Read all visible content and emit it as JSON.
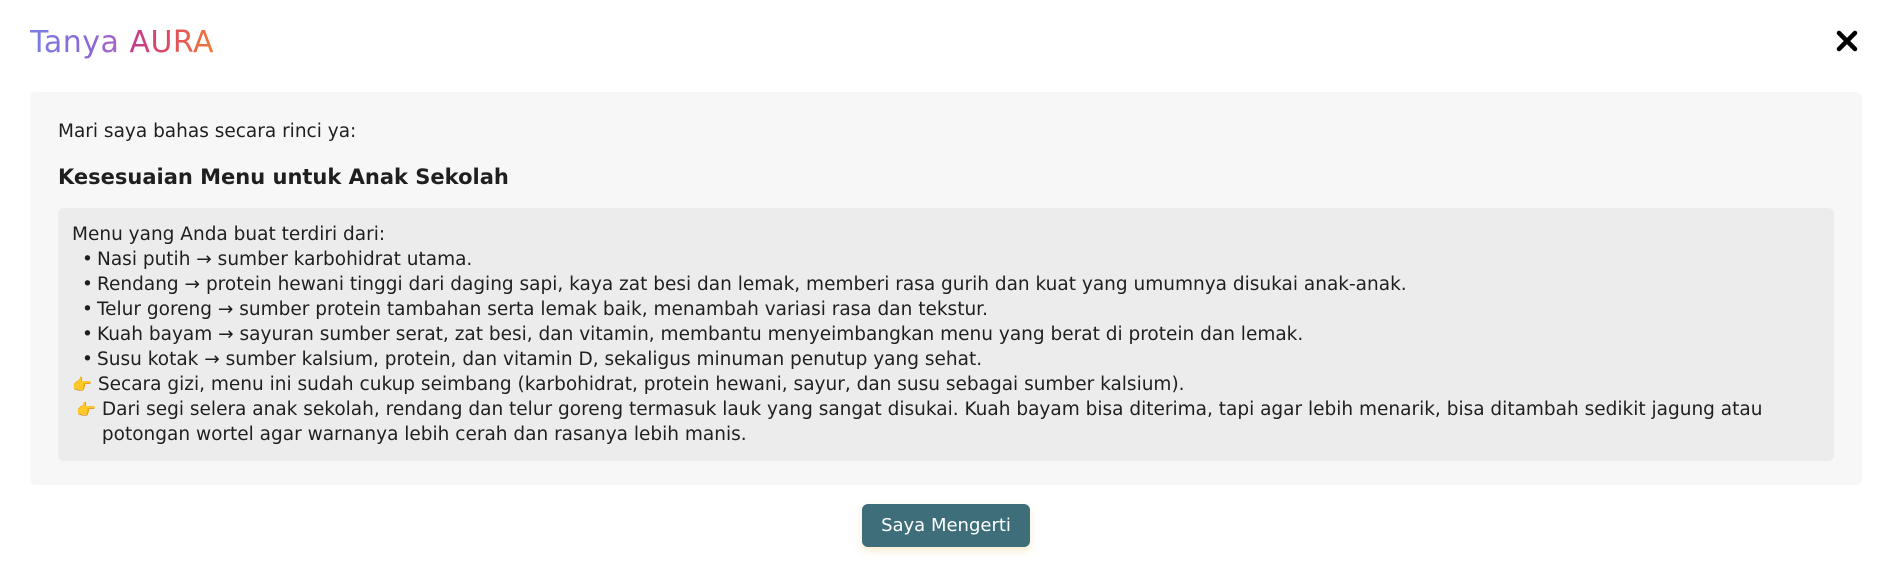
{
  "header": {
    "title_part1": "Tanya ",
    "title_part2": "AURA"
  },
  "content": {
    "intro": "Mari saya bahas secara rinci ya:",
    "section_title": "Kesesuaian Menu untuk Anak Sekolah",
    "menu_intro": "Menu yang Anda buat terdiri dari:",
    "bullets": [
      "Nasi putih → sumber karbohidrat utama.",
      "Rendang → protein hewani tinggi dari daging sapi, kaya zat besi dan lemak, memberi rasa gurih dan kuat yang umumnya disukai anak-anak.",
      "Telur goreng → sumber protein tambahan serta lemak baik, menambah variasi rasa dan tekstur.",
      "Kuah bayam → sayuran sumber serat, zat besi, dan vitamin, membantu menyeimbangkan menu yang berat di protein dan lemak.",
      "Susu kotak → sumber kalsium, protein, dan vitamin D, sekaligus minuman penutup yang sehat."
    ],
    "notes": [
      {
        "emoji": "👉",
        "text": "Secara gizi, menu ini sudah cukup seimbang (karbohidrat, protein hewani, sayur, dan susu sebagai sumber kalsium)."
      },
      {
        "emoji": "👉",
        "text": "Dari segi selera anak sekolah, rendang dan telur goreng termasuk lauk yang sangat disukai. Kuah bayam bisa diterima, tapi agar lebih menarik, bisa ditambah sedikit jagung atau potongan wortel agar warnanya lebih cerah dan rasanya lebih manis."
      }
    ]
  },
  "footer": {
    "confirm_label": "Saya Mengerti"
  },
  "icons": {
    "close": "close-icon"
  },
  "colors": {
    "button_bg": "#3d6e7a",
    "card_bg": "#f7f7f7",
    "inner_bg": "#ececec"
  }
}
